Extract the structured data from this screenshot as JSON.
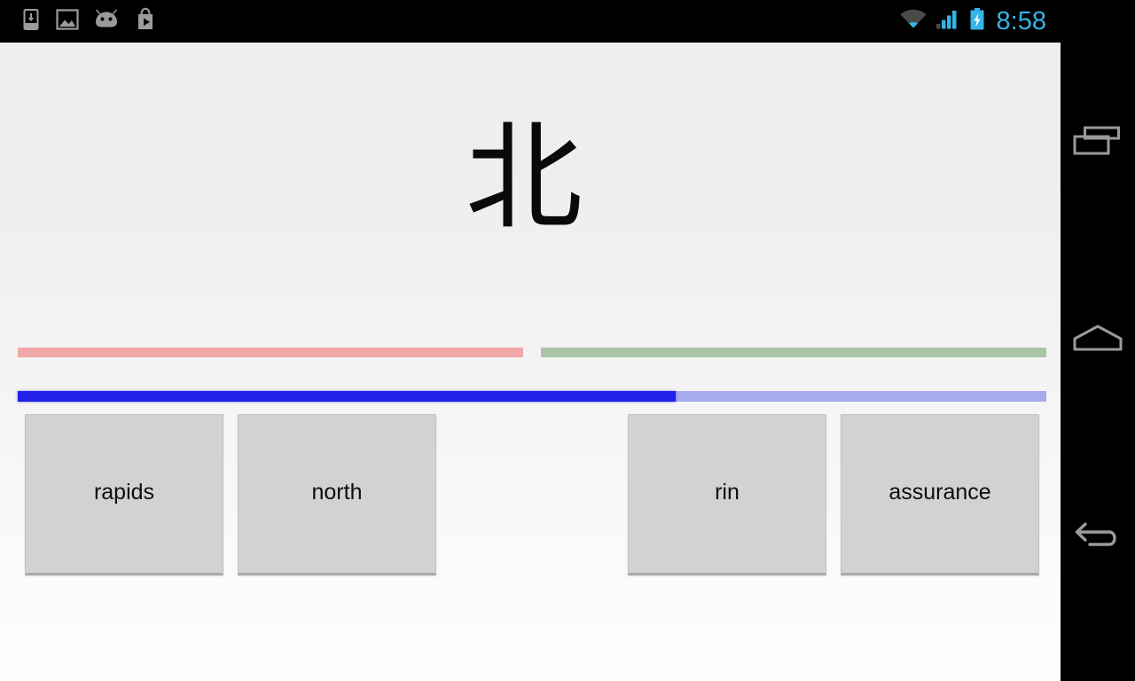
{
  "status_bar": {
    "notification_icons": [
      {
        "name": "download-icon",
        "label": "Download"
      },
      {
        "name": "gallery-image-icon",
        "label": "Image"
      },
      {
        "name": "android-robot-icon",
        "label": "Android"
      },
      {
        "name": "play-store-icon",
        "label": "Play Store"
      }
    ],
    "wifi_icon": "wifi-icon",
    "signal_icon": "cellular-signal-icon",
    "battery_icon": "battery-charging-icon",
    "time": "8:58",
    "accent_color": "#33b5e5",
    "background_color": "#000000"
  },
  "quiz": {
    "prompt_character": "北",
    "prompt_label": "prompt-character",
    "segment_bar": {
      "red_color": "#f2a8a8",
      "green_color": "#aac4a8",
      "red_fraction": 0.49,
      "green_fraction": 0.49
    },
    "progress_bar": {
      "fill_color": "#2020e8",
      "track_color": "#a8aaf0",
      "percent": 64
    },
    "answers": [
      {
        "label": "rapids",
        "slot": 0
      },
      {
        "label": "north",
        "slot": 1
      },
      {
        "label": "rin",
        "slot": 2
      },
      {
        "label": "assurance",
        "slot": 3
      }
    ],
    "button_color": "#d2d2d2",
    "background_top": "#ededed",
    "background_bottom": "#fcfcfc"
  },
  "nav_bar": {
    "background_color": "#000000",
    "icon_color": "#9a9a9a",
    "buttons": [
      {
        "name": "recents-button",
        "icon": "recents-icon",
        "label": "Recent apps"
      },
      {
        "name": "home-button",
        "icon": "home-icon",
        "label": "Home"
      },
      {
        "name": "back-button",
        "icon": "back-arrow-icon",
        "label": "Back"
      }
    ]
  }
}
